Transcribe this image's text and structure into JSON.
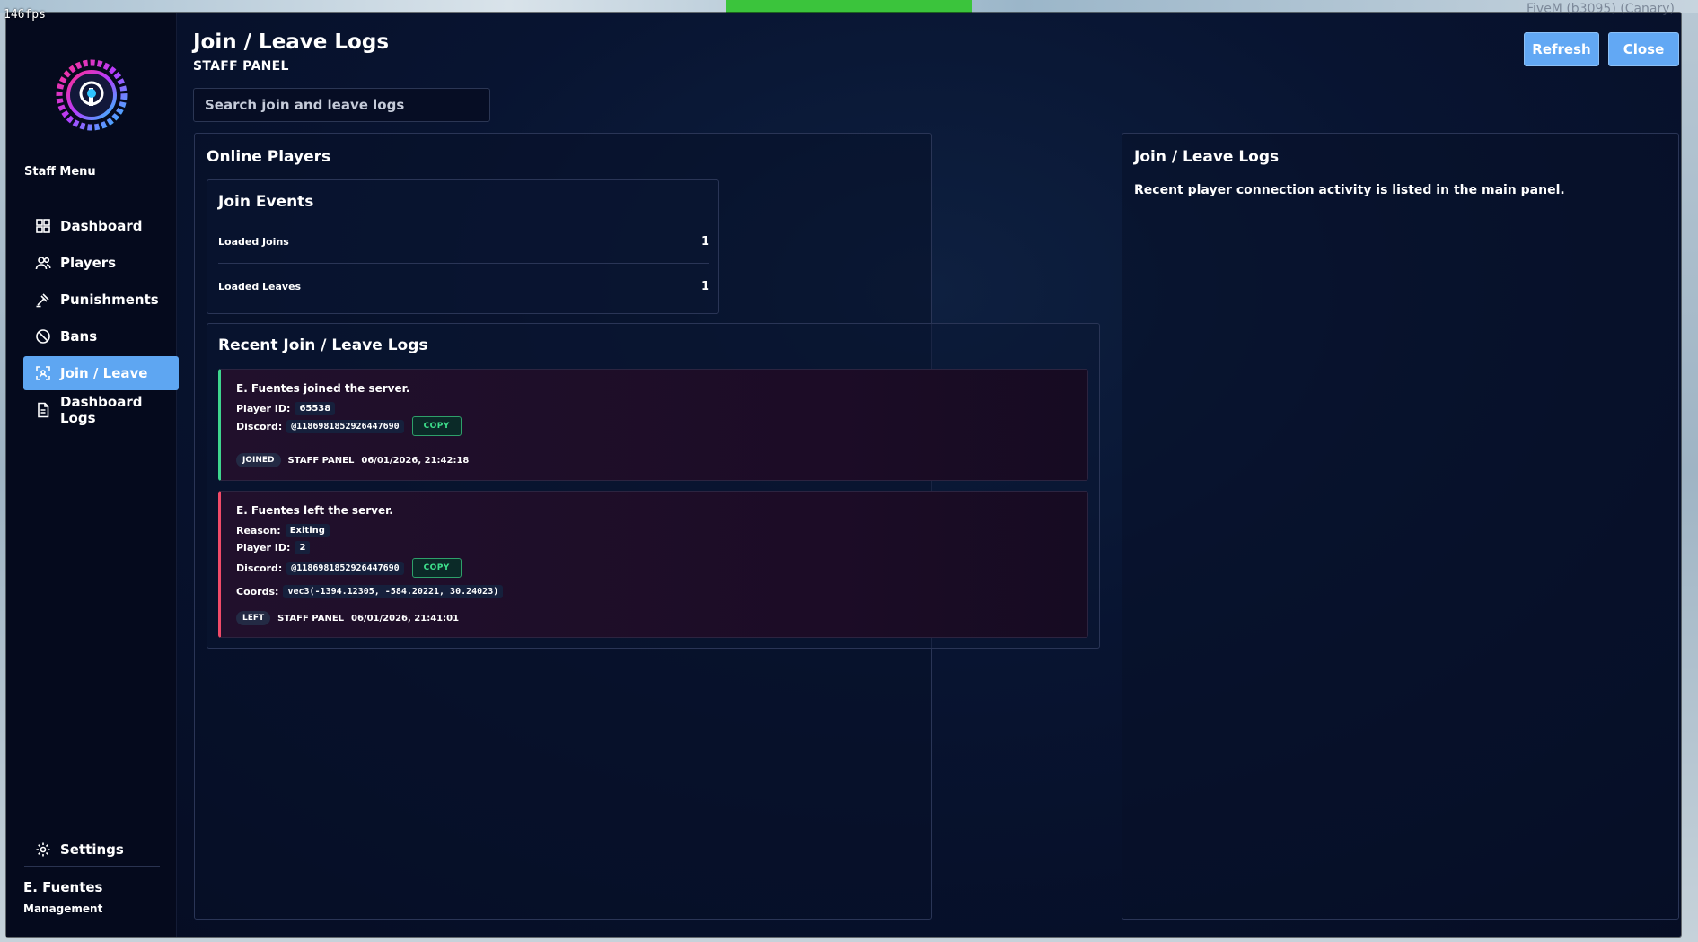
{
  "overlay": {
    "fps": "146fps",
    "build": "FiveM (b3095) (Canary)"
  },
  "sidebar": {
    "menu_title": "Staff Menu",
    "items": [
      {
        "label": "Dashboard",
        "icon": "dashboard-icon",
        "active": false
      },
      {
        "label": "Players",
        "icon": "players-icon",
        "active": false
      },
      {
        "label": "Punishments",
        "icon": "gavel-icon",
        "active": false
      },
      {
        "label": "Bans",
        "icon": "ban-icon",
        "active": false
      },
      {
        "label": "Join / Leave",
        "icon": "join-leave-icon",
        "active": true
      },
      {
        "label": "Dashboard Logs",
        "icon": "document-icon",
        "active": false
      }
    ],
    "settings_label": "Settings",
    "user": {
      "name": "E. Fuentes",
      "role": "Management"
    }
  },
  "header": {
    "title": "Join / Leave Logs",
    "subtitle": "STAFF PANEL",
    "refresh_label": "Refresh",
    "close_label": "Close"
  },
  "search": {
    "placeholder": "Search join and leave logs",
    "value": ""
  },
  "main": {
    "title": "Online Players",
    "join_events": {
      "title": "Join Events",
      "stats": [
        {
          "label": "Loaded Joins",
          "value": "1"
        },
        {
          "label": "Loaded Leaves",
          "value": "1"
        }
      ]
    },
    "recent": {
      "title": "Recent Join / Leave Logs",
      "logs": [
        {
          "type": "joined",
          "headline": "E. Fuentes joined the server.",
          "player_id_label": "Player ID:",
          "player_id": "65538",
          "discord_label": "Discord:",
          "discord": "@1186981852926447690",
          "copy_label": "COPY",
          "tag": "JOINED",
          "source": "STAFF PANEL",
          "timestamp": "06/01/2026, 21:42:18"
        },
        {
          "type": "left",
          "headline": "E. Fuentes left the server.",
          "reason_label": "Reason:",
          "reason": "Exiting",
          "player_id_label": "Player ID:",
          "player_id": "2",
          "discord_label": "Discord:",
          "discord": "@1186981852926447690",
          "copy_label": "COPY",
          "coords_label": "Coords:",
          "coords": "vec3(-1394.12305, -584.20221, 30.24023)",
          "tag": "LEFT",
          "source": "STAFF PANEL",
          "timestamp": "06/01/2026, 21:41:01"
        }
      ]
    }
  },
  "side_panel": {
    "title": "Join / Leave Logs",
    "text": "Recent player connection activity is listed in the main panel."
  },
  "colors": {
    "accent": "#62a8f4",
    "joined": "#3ed58e",
    "left": "#f04a68",
    "background": "#081431"
  }
}
